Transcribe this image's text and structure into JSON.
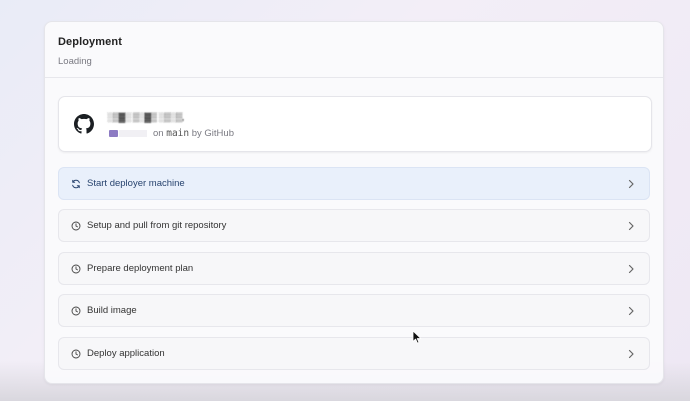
{
  "panel": {
    "title": "Deployment",
    "status": "Loading"
  },
  "repo": {
    "name": "░▒▓░ ▒░▓▒ ░▒░▒,",
    "on_text": "on",
    "branch": "main",
    "by_text": "by GitHub",
    "icon": "github-icon"
  },
  "steps": [
    {
      "label": "Start deployer machine",
      "icon": "refresh-icon",
      "state": "active"
    },
    {
      "label": "Setup and pull from git repository",
      "icon": "clock-icon",
      "state": "pending"
    },
    {
      "label": "Prepare deployment plan",
      "icon": "clock-icon",
      "state": "pending"
    },
    {
      "label": "Build image",
      "icon": "clock-icon",
      "state": "pending"
    },
    {
      "label": "Deploy application",
      "icon": "clock-icon",
      "state": "pending"
    }
  ],
  "colors": {
    "active_step_bg": "#e9f0fb",
    "active_step_text": "#27436e",
    "redaction": "#8d7bc3"
  }
}
